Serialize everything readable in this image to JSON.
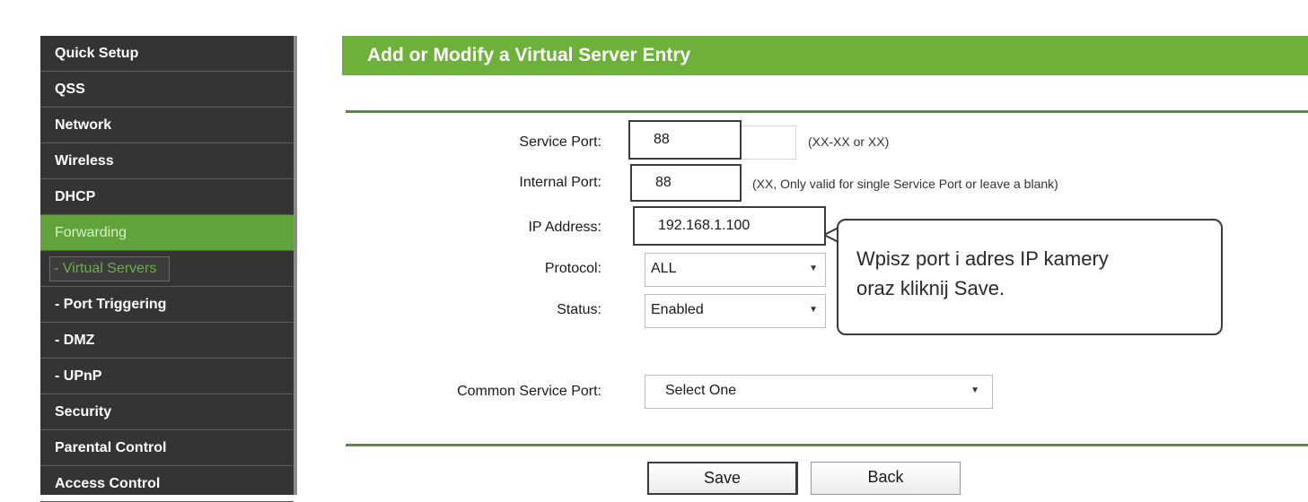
{
  "sidebar": {
    "items": [
      {
        "label": "Quick Setup"
      },
      {
        "label": "QSS"
      },
      {
        "label": "Network"
      },
      {
        "label": "Wireless"
      },
      {
        "label": "DHCP"
      },
      {
        "label": "Forwarding"
      },
      {
        "label": "- Virtual Servers"
      },
      {
        "label": "- Port Triggering"
      },
      {
        "label": "- DMZ"
      },
      {
        "label": "- UPnP"
      },
      {
        "label": "Security"
      },
      {
        "label": "Parental Control"
      },
      {
        "label": "Access Control"
      }
    ]
  },
  "header": {
    "title": "Add or Modify a Virtual Server Entry"
  },
  "form": {
    "service_port": {
      "label": "Service Port:",
      "value": "88",
      "hint": "(XX-XX or XX)"
    },
    "internal_port": {
      "label": "Internal Port:",
      "value": "88",
      "hint": "(XX, Only valid for single Service Port or leave a blank)"
    },
    "ip_address": {
      "label": "IP Address:",
      "value": "192.168.1.100"
    },
    "protocol": {
      "label": "Protocol:",
      "value": "ALL"
    },
    "status": {
      "label": "Status:",
      "value": "Enabled"
    },
    "common_service_port": {
      "label": "Common Service Port:",
      "value": "Select One"
    }
  },
  "callout": {
    "line1": "Wpisz port i adres IP kamery",
    "line2": "oraz kliknij Save."
  },
  "buttons": {
    "save": "Save",
    "back": "Back"
  },
  "colors": {
    "sidebar_bg": "#343434",
    "accent_green": "#6db13b",
    "active_item": "#5fa33a"
  }
}
